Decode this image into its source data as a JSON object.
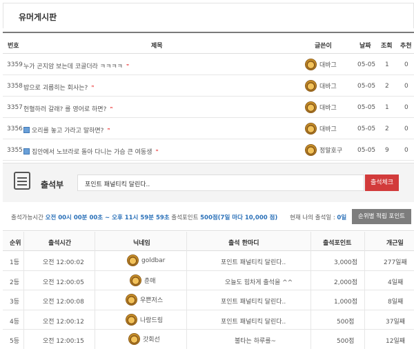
{
  "board": {
    "title": "유머게시판"
  },
  "list": {
    "headers": {
      "num": "번호",
      "title": "제목",
      "author": "글쓴이",
      "date": "날짜",
      "views": "조회",
      "rec": "추천"
    },
    "rows": [
      {
        "num": "3359",
        "title": "누가 곤지암 보는데 코골더라 ㅋㅋㅋㅋ",
        "thumb": false,
        "author": "대바그",
        "date": "05-05",
        "views": "1",
        "rec": "0"
      },
      {
        "num": "3358",
        "title": "밥으로 괴롭히는 회사는?",
        "thumb": false,
        "author": "대바그",
        "date": "05-05",
        "views": "2",
        "rec": "0"
      },
      {
        "num": "3357",
        "title": "헌혈하러 갈래? 를 영어로 하면?",
        "thumb": false,
        "author": "대바그",
        "date": "05-05",
        "views": "1",
        "rec": "0"
      },
      {
        "num": "3356",
        "title": "오리를 놓고 가라고 말하면?",
        "thumb": true,
        "author": "대바그",
        "date": "05-05",
        "views": "2",
        "rec": "0"
      },
      {
        "num": "3355",
        "title": "집안에서 노브라로 돌아 다니는 가슴 큰 여동생",
        "thumb": true,
        "author": "정말호구",
        "date": "05-05",
        "views": "9",
        "rec": "0"
      }
    ]
  },
  "attendance": {
    "title": "출석부",
    "input_value": "포인트 패널티킥 달린다..",
    "check_button": "출석체크",
    "info_prefix": "출석가능시간 ",
    "info_time": "오전 00시 00분 00초 ~ 오후 11시 59분 59초",
    "info_mid": " 출석포인트 ",
    "info_points": "500점(7일 마다 10,000 점)",
    "my_label": "현재 나의 출석일 : ",
    "my_count": "0일",
    "rank_button": "순위별 적립 포인트",
    "headers": {
      "rank": "순위",
      "time": "출석시간",
      "nick": "닉네임",
      "msg": "출석 한마디",
      "points": "출석포인트",
      "days": "개근일"
    },
    "rows": [
      {
        "rank": "1등",
        "time": "오전 12:00:02",
        "nick": "goldbar",
        "msg": "포인트 패널티킥 달린다..",
        "points": "3,000점",
        "days": "277일째"
      },
      {
        "rank": "2등",
        "time": "오전 12:00:05",
        "nick": "춘매",
        "msg": "오늘도 힘차게 출석을 ^^",
        "points": "2,000점",
        "days": "4일째"
      },
      {
        "rank": "3등",
        "time": "오전 12:00:08",
        "nick": "우쁜저스",
        "msg": "포인트 패널티킥 달린다..",
        "points": "1,000점",
        "days": "8일째"
      },
      {
        "rank": "4등",
        "time": "오전 12:00:12",
        "nick": "나랑드링",
        "msg": "포인트 패널티킥 달린다..",
        "points": "500점",
        "days": "37일째"
      },
      {
        "rank": "5등",
        "time": "오전 12:00:15",
        "nick": "갓회선",
        "msg": "불타는 하루를~",
        "points": "500점",
        "days": "12일째"
      }
    ]
  }
}
